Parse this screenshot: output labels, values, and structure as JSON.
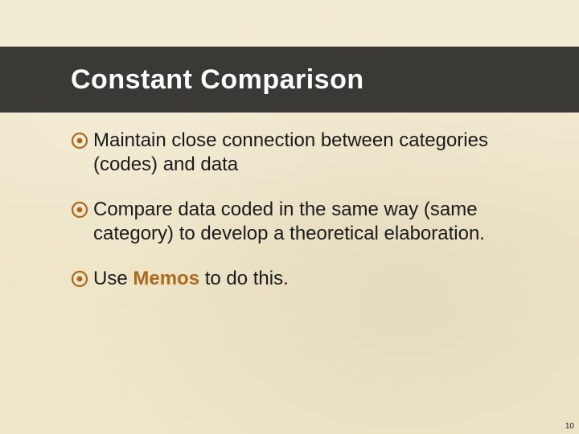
{
  "title": "Constant Comparison",
  "bullets": [
    {
      "text": "Maintain close connection between categories (codes) and data"
    },
    {
      "text": "Compare data coded in the same way (same category) to develop a theoretical elaboration."
    },
    {
      "pre": "Use ",
      "emph": "Memos",
      "post": " to do this."
    }
  ],
  "colors": {
    "accent": "#a96a1f",
    "titlebar": "#3a3935",
    "background": "#efe7cd"
  },
  "icon": "bullet-target-icon",
  "page_number": "10"
}
